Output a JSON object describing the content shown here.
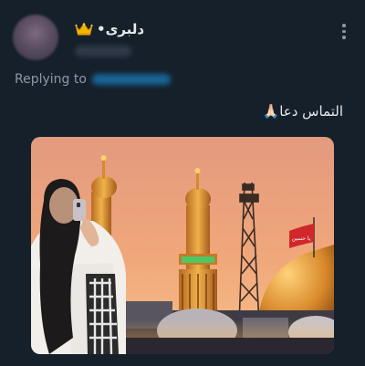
{
  "header": {
    "display_name": "دلبری•",
    "crown_icon": "crown-icon",
    "more_icon": "more-vertical-icon"
  },
  "reply": {
    "label": "Replying to"
  },
  "tweet": {
    "text": "التماس دعا🙏🏻"
  },
  "photo": {
    "flag_text": "يا حسين"
  },
  "colors": {
    "background": "#15202b",
    "muted": "#8b98a5",
    "link": "#1d9bf0"
  }
}
